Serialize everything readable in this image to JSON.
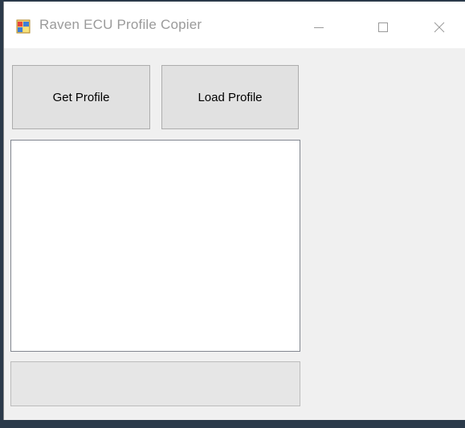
{
  "window": {
    "title": "Raven ECU Profile Copier",
    "icon": "winforms-app-icon"
  },
  "caption_buttons": {
    "minimize_icon": "minimize-icon",
    "maximize_icon": "maximize-icon",
    "close_icon": "close-icon"
  },
  "buttons": {
    "get_profile_label": "Get Profile",
    "load_profile_label": "Load Profile"
  },
  "listbox": {
    "items": []
  },
  "progress": {
    "value_percent": 0
  },
  "colors": {
    "title_text": "#9a9a9a",
    "window_bg": "#f0f0f0",
    "button_bg": "#e1e1e1",
    "button_border": "#adadad",
    "progress_fill": "#06b025"
  }
}
